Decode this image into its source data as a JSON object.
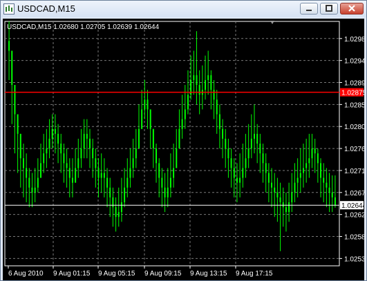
{
  "window": {
    "title": "USDCAD,M15"
  },
  "chart_data": {
    "type": "candlestick",
    "symbol_info": "USDCAD,M15  1.02680 1.02705 1.02639 1.02644",
    "ylim": [
      1.0252,
      1.0302
    ],
    "y_ticks": [
      "1.02985",
      "1.02940",
      "1.02895",
      "1.02850",
      "1.02805",
      "1.02760",
      "1.02715",
      "1.02670",
      "1.02625",
      "1.02580",
      "1.02535"
    ],
    "x_ticks": [
      "6 Aug 2010",
      "9 Aug 01:15",
      "9 Aug 05:15",
      "9 Aug 09:15",
      "9 Aug 13:15",
      "9 Aug 17:15"
    ],
    "ask_line": {
      "value": "1.02875",
      "color": "#ff0000"
    },
    "current_price": "1.02644",
    "grid": true,
    "colors": {
      "background": "#000000",
      "candles": "#00ff00",
      "axis_text": "#ffffff",
      "grid": "#7a7a7a"
    },
    "closes": [
      1.0296,
      1.0289,
      1.0283,
      1.0279,
      1.0274,
      1.0272,
      1.027,
      1.0268,
      1.0267,
      1.0268,
      1.027,
      1.0273,
      1.0275,
      1.0276,
      1.0278,
      1.028,
      1.0279,
      1.0277,
      1.0275,
      1.0273,
      1.0272,
      1.027,
      1.0269,
      1.0272,
      1.0274,
      1.0276,
      1.0279,
      1.0278,
      1.0276,
      1.0274,
      1.0272,
      1.027,
      1.0271,
      1.027,
      1.0268,
      1.0266,
      1.0264,
      1.0262,
      1.0263,
      1.0265,
      1.0268,
      1.027,
      1.0272,
      1.0274,
      1.0276,
      1.028,
      1.0284,
      1.0286,
      1.0284,
      1.028,
      1.0276,
      1.0273,
      1.027,
      1.0268,
      1.0266,
      1.0268,
      1.027,
      1.0272,
      1.0276,
      1.028,
      1.0282,
      1.0284,
      1.0287,
      1.029,
      1.0291,
      1.0289,
      1.0287,
      1.0288,
      1.029,
      1.0291,
      1.0288,
      1.0286,
      1.0283,
      1.028,
      1.0278,
      1.0276,
      1.0274,
      1.0272,
      1.027,
      1.0269,
      1.027,
      1.0272,
      1.0274,
      1.0276,
      1.0278,
      1.0279,
      1.0277,
      1.0275,
      1.0273,
      1.0271,
      1.0269,
      1.0268,
      1.0267,
      1.0266,
      1.0265,
      1.0264,
      1.0263,
      1.0265,
      1.0267,
      1.0269,
      1.027,
      1.0271,
      1.0272,
      1.0273,
      1.0274,
      1.0276,
      1.0275,
      1.0273,
      1.027,
      1.0269,
      1.0268,
      1.0267,
      1.0266,
      1.02644
    ],
    "highs": [
      1.0302,
      1.0296,
      1.0289,
      1.0282,
      1.0279,
      1.0277,
      1.0275,
      1.0272,
      1.0271,
      1.0272,
      1.0274,
      1.0277,
      1.0279,
      1.028,
      1.0282,
      1.0283,
      1.0283,
      1.0281,
      1.0279,
      1.0277,
      1.0276,
      1.0274,
      1.0274,
      1.0276,
      1.0278,
      1.028,
      1.0282,
      1.0282,
      1.028,
      1.0278,
      1.0276,
      1.0274,
      1.0275,
      1.0274,
      1.0272,
      1.027,
      1.0268,
      1.0266,
      1.0268,
      1.027,
      1.0272,
      1.0274,
      1.0276,
      1.0278,
      1.028,
      1.0285,
      1.0288,
      1.029,
      1.0288,
      1.0284,
      1.028,
      1.0277,
      1.0274,
      1.0272,
      1.0271,
      1.0272,
      1.0275,
      1.0277,
      1.028,
      1.0284,
      1.0287,
      1.0289,
      1.0292,
      1.0295,
      1.0296,
      1.03,
      1.0292,
      1.0293,
      1.0295,
      1.0296,
      1.0292,
      1.029,
      1.0288,
      1.0285,
      1.0282,
      1.028,
      1.0278,
      1.0276,
      1.0274,
      1.0273,
      1.0275,
      1.0277,
      1.0279,
      1.0281,
      1.0283,
      1.0285,
      1.0281,
      1.0279,
      1.0277,
      1.0275,
      1.0273,
      1.0272,
      1.0271,
      1.027,
      1.0269,
      1.0268,
      1.0267,
      1.0269,
      1.0271,
      1.0273,
      1.0274,
      1.0276,
      1.0277,
      1.0278,
      1.0279,
      1.0279,
      1.0278,
      1.0276,
      1.0274,
      1.0273,
      1.0272,
      1.0271,
      1.02705,
      1.02705
    ],
    "lows": [
      1.029,
      1.0281,
      1.0275,
      1.0271,
      1.0268,
      1.0266,
      1.0265,
      1.0264,
      1.0264,
      1.0265,
      1.0267,
      1.027,
      1.0271,
      1.0272,
      1.0274,
      1.0276,
      1.0275,
      1.0273,
      1.0271,
      1.0269,
      1.0268,
      1.0266,
      1.0266,
      1.0269,
      1.027,
      1.0272,
      1.0274,
      1.0274,
      1.0272,
      1.027,
      1.0268,
      1.0266,
      1.0267,
      1.0266,
      1.0264,
      1.0262,
      1.026,
      1.0259,
      1.026,
      1.0261,
      1.0264,
      1.0266,
      1.0268,
      1.027,
      1.0272,
      1.0276,
      1.028,
      1.0282,
      1.028,
      1.0276,
      1.0272,
      1.0269,
      1.0266,
      1.0264,
      1.0263,
      1.0264,
      1.0266,
      1.0268,
      1.0272,
      1.0276,
      1.0278,
      1.028,
      1.0283,
      1.0286,
      1.0287,
      1.0285,
      1.0283,
      1.0284,
      1.0286,
      1.0287,
      1.0284,
      1.0282,
      1.0279,
      1.0276,
      1.0274,
      1.0272,
      1.027,
      1.0268,
      1.0266,
      1.0265,
      1.0266,
      1.0268,
      1.027,
      1.0272,
      1.0274,
      1.0275,
      1.0273,
      1.0271,
      1.0269,
      1.0267,
      1.0265,
      1.0264,
      1.0262,
      1.0261,
      1.0255,
      1.026,
      1.0259,
      1.0261,
      1.0263,
      1.0265,
      1.0266,
      1.0267,
      1.0268,
      1.0269,
      1.027,
      1.0272,
      1.0271,
      1.0269,
      1.0266,
      1.0265,
      1.0264,
      1.0263,
      1.0263,
      1.02639
    ]
  }
}
